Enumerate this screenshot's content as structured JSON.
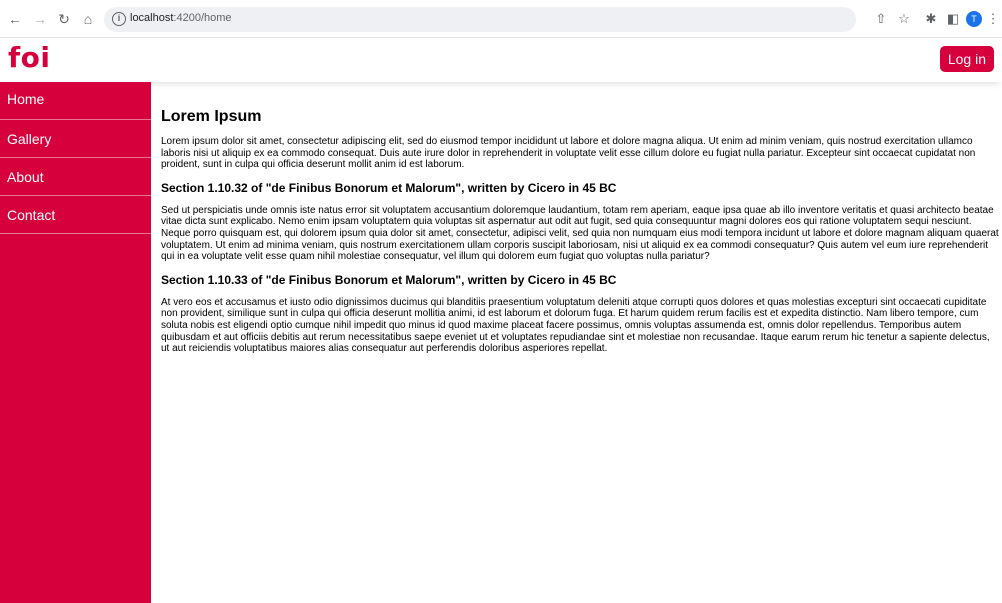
{
  "browser": {
    "url_host": "localhost",
    "url_path": ":4200/home",
    "profile_initial": "T"
  },
  "app": {
    "logo_text": "foi",
    "login_label": "Log in"
  },
  "sidebar": {
    "items": [
      {
        "label": "Home"
      },
      {
        "label": "Gallery"
      },
      {
        "label": "About"
      },
      {
        "label": "Contact"
      }
    ]
  },
  "content": {
    "title": "Lorem Ipsum",
    "intro": "Lorem ipsum dolor sit amet, consectetur adipiscing elit, sed do eiusmod tempor incididunt ut labore et dolore magna aliqua. Ut enim ad minim veniam, quis nostrud exercitation ullamco laboris nisi ut aliquip ex ea commodo consequat. Duis aute irure dolor in reprehenderit in voluptate velit esse cillum dolore eu fugiat nulla pariatur. Excepteur sint occaecat cupidatat non proident, sunt in culpa qui officia deserunt mollit anim id est laborum.",
    "section1_title": "Section 1.10.32 of \"de Finibus Bonorum et Malorum\", written by Cicero in 45 BC",
    "section1_text": "Sed ut perspiciatis unde omnis iste natus error sit voluptatem accusantium doloremque laudantium, totam rem aperiam, eaque ipsa quae ab illo inventore veritatis et quasi architecto beatae vitae dicta sunt explicabo. Nemo enim ipsam voluptatem quia voluptas sit aspernatur aut odit aut fugit, sed quia consequuntur magni dolores eos qui ratione voluptatem sequi nesciunt. Neque porro quisquam est, qui dolorem ipsum quia dolor sit amet, consectetur, adipisci velit, sed quia non numquam eius modi tempora incidunt ut labore et dolore magnam aliquam quaerat voluptatem. Ut enim ad minima veniam, quis nostrum exercitationem ullam corporis suscipit laboriosam, nisi ut aliquid ex ea commodi consequatur? Quis autem vel eum iure reprehenderit qui in ea voluptate velit esse quam nihil molestiae consequatur, vel illum qui dolorem eum fugiat quo voluptas nulla pariatur?",
    "section2_title": "Section 1.10.33 of \"de Finibus Bonorum et Malorum\", written by Cicero in 45 BC",
    "section2_text": "At vero eos et accusamus et iusto odio dignissimos ducimus qui blanditiis praesentium voluptatum deleniti atque corrupti quos dolores et quas molestias excepturi sint occaecati cupiditate non provident, similique sunt in culpa qui officia deserunt mollitia animi, id est laborum et dolorum fuga. Et harum quidem rerum facilis est et expedita distinctio. Nam libero tempore, cum soluta nobis est eligendi optio cumque nihil impedit quo minus id quod maxime placeat facere possimus, omnis voluptas assumenda est, omnis dolor repellendus. Temporibus autem quibusdam et aut officiis debitis aut rerum necessitatibus saepe eveniet ut et voluptates repudiandae sint et molestiae non recusandae. Itaque earum rerum hic tenetur a sapiente delectus, ut aut reiciendis voluptatibus maiores alias consequatur aut perferendis doloribus asperiores repellat."
  },
  "colors": {
    "brand": "#d6003c"
  },
  "icons": [
    "back-arrow-icon",
    "forward-arrow-icon",
    "reload-icon",
    "home-icon",
    "info-icon",
    "share-icon",
    "star-icon",
    "extensions-icon",
    "sidepanel-icon",
    "menu-dots-icon"
  ]
}
